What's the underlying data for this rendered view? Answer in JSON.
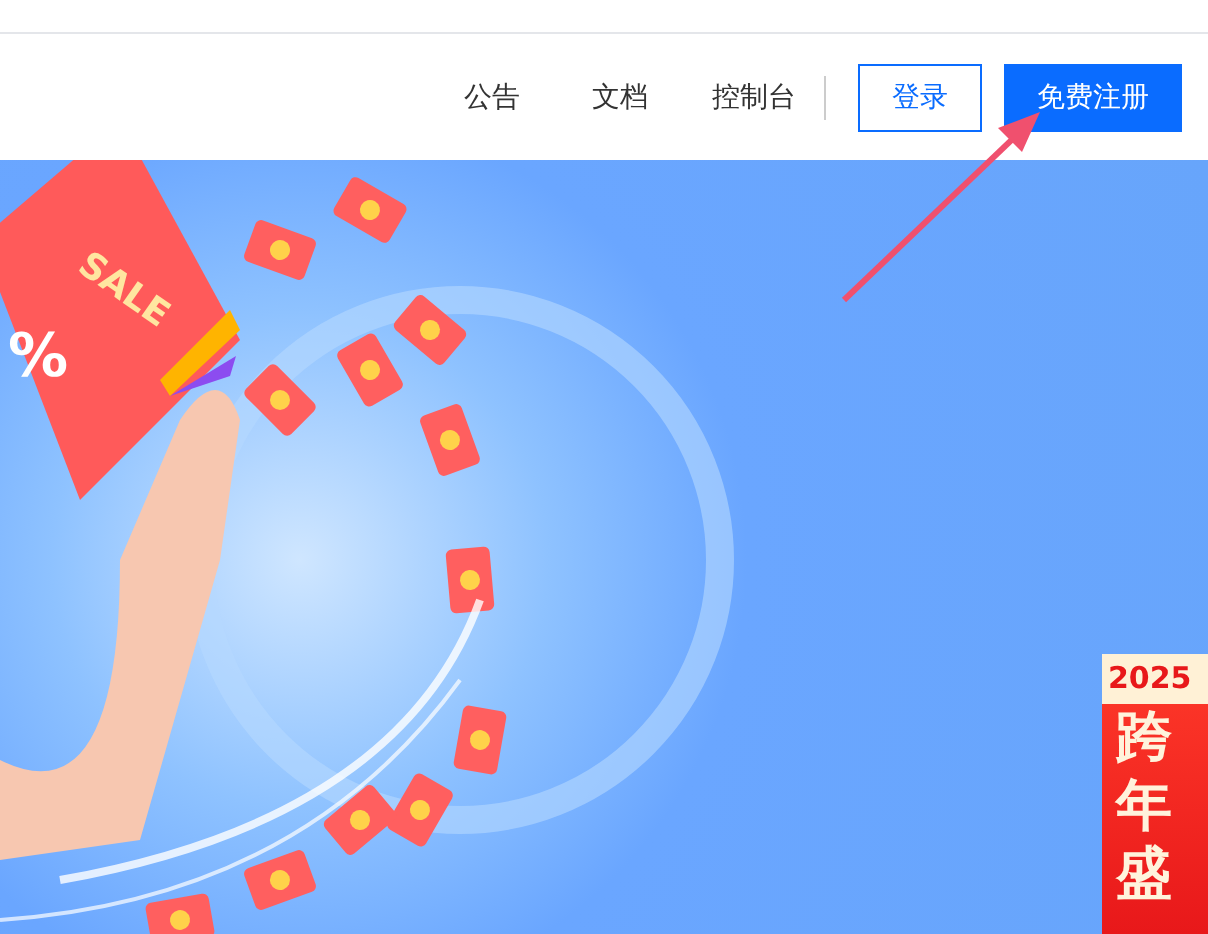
{
  "nav": {
    "links": [
      {
        "label": "公告"
      },
      {
        "label": "文档"
      },
      {
        "label": "控制台"
      }
    ],
    "login": "登录",
    "register": "免费注册"
  },
  "banner": {
    "ticket_text": "SALE",
    "ticket_mark": "%",
    "promo": {
      "year": "2025",
      "chars": [
        "跨",
        "年",
        "盛"
      ]
    }
  }
}
